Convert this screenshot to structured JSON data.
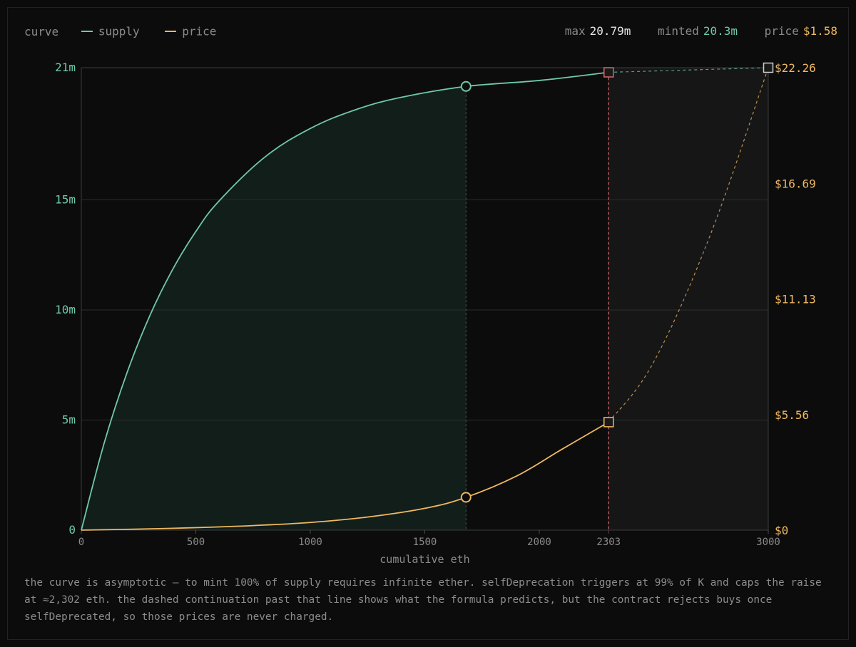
{
  "header": {
    "legend_title": "curve",
    "legend_items": [
      {
        "label": "supply",
        "color": "#6fc9a8"
      },
      {
        "label": "price",
        "color": "#f0b860"
      }
    ],
    "stats": [
      {
        "label": "max",
        "value": "20.79m",
        "color": "#e6e6e6"
      },
      {
        "label": "minted",
        "value": "20.3m",
        "color": "#6fc9a8"
      },
      {
        "label": "price",
        "value": "$1.58",
        "color": "#f0b860"
      }
    ]
  },
  "colors": {
    "supply": "#6fc9a8",
    "price": "#f0b860",
    "cap_line": "#d46a6a",
    "grid": "#2a2d2b",
    "axis_text": "#8a8a8a"
  },
  "chart_data": {
    "type": "line",
    "xlabel": "cumulative eth",
    "x_ticks": [
      "0",
      "500",
      "1000",
      "1500",
      "2000",
      "2303",
      "3000"
    ],
    "x_tick_values": [
      0,
      500,
      1000,
      1500,
      2000,
      2303,
      3000
    ],
    "xlim": [
      0,
      3000
    ],
    "y_left_ticks": [
      "0",
      "5m",
      "10m",
      "15m",
      "21m"
    ],
    "y_left_tick_values": [
      0,
      5,
      10,
      15,
      21
    ],
    "y_left_lim": [
      0,
      21
    ],
    "y_left_unit": "m",
    "y_right_ticks": [
      "$0",
      "$5.56",
      "$11.13",
      "$16.69",
      "$22.26"
    ],
    "y_right_tick_values": [
      0,
      5.56,
      11.13,
      16.69,
      22.26
    ],
    "y_right_lim": [
      0,
      22.26
    ],
    "cap_x": 2303,
    "current_x": 1680,
    "series": [
      {
        "name": "supply",
        "axis": "left",
        "x": [
          0,
          100,
          200,
          300,
          400,
          500,
          600,
          800,
          1000,
          1200,
          1400,
          1680,
          2000,
          2303,
          3000
        ],
        "values": [
          0,
          3.96,
          7.16,
          9.76,
          11.86,
          13.56,
          14.93,
          16.93,
          18.24,
          19.1,
          19.66,
          20.15,
          20.42,
          20.79,
          21.0
        ]
      },
      {
        "name": "price",
        "axis": "left",
        "axis_note": "right",
        "x": [
          0,
          250,
          500,
          750,
          1000,
          1250,
          1500,
          1680,
          1900,
          2100,
          2303,
          2500,
          2750,
          3000
        ],
        "values": [
          0.0,
          0.05,
          0.12,
          0.22,
          0.37,
          0.63,
          1.05,
          1.58,
          2.6,
          3.9,
          5.2,
          8.1,
          14.3,
          22.26
        ]
      }
    ],
    "grid": true,
    "legend_position": "top-left"
  },
  "note": "the curve is asymptotic — to mint 100% of supply requires infinite ether. selfDeprecation triggers at 99% of K and caps the raise at ≈2,302 eth. the dashed continuation past that line shows what the formula predicts, but the contract rejects buys once selfDeprecated, so those prices are never charged."
}
